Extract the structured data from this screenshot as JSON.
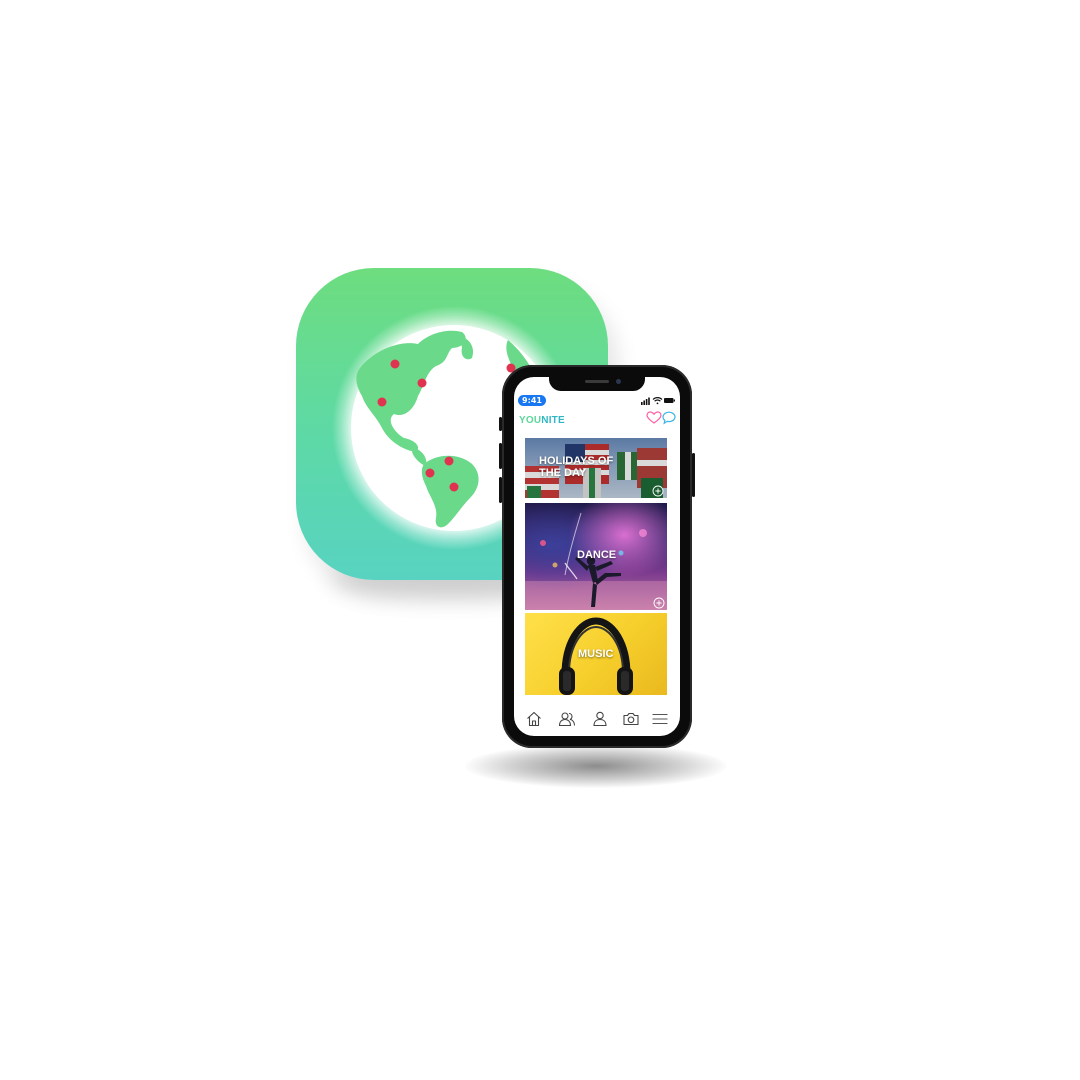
{
  "status_bar": {
    "time": "9:41"
  },
  "header": {
    "brand_part1": "YOU",
    "brand_part2": "NITE"
  },
  "cards": [
    {
      "label": "HOLIDAYS OF THE DAY"
    },
    {
      "label": "DANCE"
    },
    {
      "label": "MUSIC"
    }
  ],
  "tabbar": {
    "items": [
      "home-icon",
      "friends-icon",
      "profile-icon",
      "camera-icon",
      "menu-icon"
    ]
  },
  "colors": {
    "brand_green": "#5cd69a",
    "brand_teal": "#2fb6c5",
    "icon_gradient_top": "#6edd7f",
    "icon_gradient_bottom": "#58d3c1",
    "globe_land": "#6ad98a",
    "globe_dots": "#e0334f",
    "heart": "#ff5fa2",
    "chat": "#3fb7e6",
    "time_pill": "#1877f2"
  }
}
